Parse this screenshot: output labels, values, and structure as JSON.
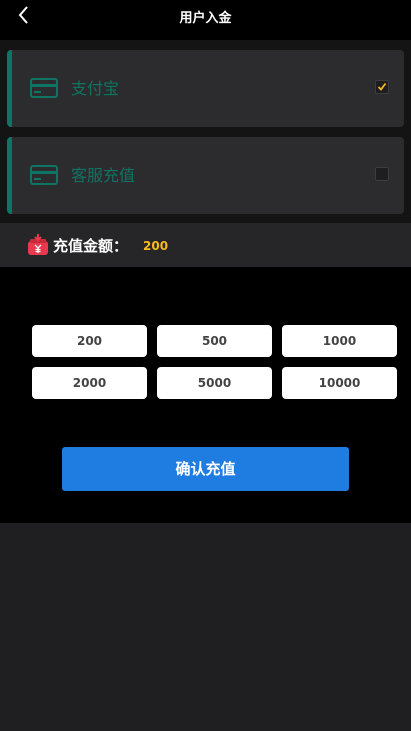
{
  "header": {
    "title": "用户入金",
    "back_icon": "chevron-left-icon"
  },
  "payment_methods": [
    {
      "label": "支付宝",
      "icon": "credit-card-icon",
      "checked": true
    },
    {
      "label": "客服充值",
      "icon": "credit-card-icon",
      "checked": false
    }
  ],
  "amount": {
    "icon": "red-wallet-yen-icon",
    "label": "充值金额：",
    "value": "200"
  },
  "presets": [
    "200",
    "500",
    "1000",
    "2000",
    "5000",
    "10000"
  ],
  "confirm_label": "确认充值",
  "colors": {
    "accent_teal": "#0e7463",
    "check_orange": "#f5b921",
    "primary_blue": "#1f7de2",
    "amount_yellow": "#f5b921"
  }
}
